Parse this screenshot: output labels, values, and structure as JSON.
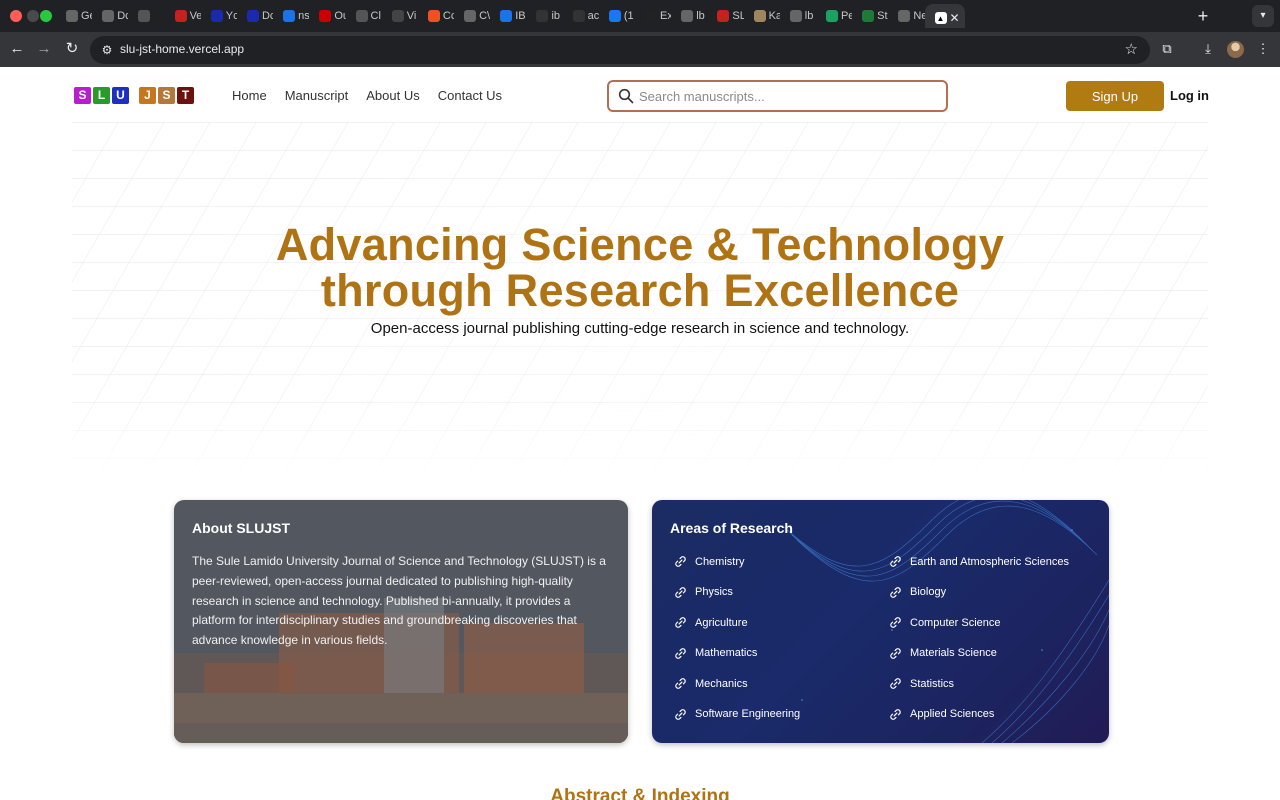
{
  "browser": {
    "tabs": [
      {
        "label": "Ge",
        "icon": "openai-icon"
      },
      {
        "label": "Dc",
        "icon": "openai-icon"
      },
      {
        "label": "",
        "icon": "link-icon"
      },
      {
        "label": "Ve",
        "icon": "gmail-icon"
      },
      {
        "label": "Yc",
        "icon": "notion-icon"
      },
      {
        "label": "Dc",
        "icon": "notion-icon"
      },
      {
        "label": "ns",
        "icon": "spinner-icon"
      },
      {
        "label": "Ou",
        "icon": "red-logo-icon"
      },
      {
        "label": "Cl",
        "icon": "link-icon"
      },
      {
        "label": "Vi",
        "icon": "vercel-icon"
      },
      {
        "label": "Cc",
        "icon": "microsoft-icon"
      },
      {
        "label": "C\\",
        "icon": "openai-icon"
      },
      {
        "label": "IB",
        "icon": "docs-icon"
      },
      {
        "label": "ib",
        "icon": "github-icon"
      },
      {
        "label": "ac",
        "icon": "github-icon"
      },
      {
        "label": "(1",
        "icon": "facebook-icon"
      },
      {
        "label": "Ex",
        "icon": "ex-icon"
      },
      {
        "label": "lb",
        "icon": "globe-icon"
      },
      {
        "label": "SL",
        "icon": "gmail-icon"
      },
      {
        "label": "Ka",
        "icon": "owl-icon"
      },
      {
        "label": "lb",
        "icon": "globe-icon"
      },
      {
        "label": "Pe",
        "icon": "play-icon"
      },
      {
        "label": "St",
        "icon": "sn-icon"
      },
      {
        "label": "Ne",
        "icon": "chrome-icon"
      }
    ],
    "url": "slu-jst-home.vercel.app"
  },
  "site": {
    "logo_letters": [
      {
        "ch": "S",
        "color": "#b81ecf"
      },
      {
        "ch": "L",
        "color": "#2a9a2a"
      },
      {
        "ch": "U",
        "color": "#1d2fbf"
      },
      {
        "ch": "J",
        "color": "#c8761d"
      },
      {
        "ch": "S",
        "color": "#b5783a"
      },
      {
        "ch": "T",
        "color": "#6e1010"
      }
    ],
    "nav": [
      "Home",
      "Manuscript",
      "About Us",
      "Contact Us"
    ],
    "search_placeholder": "Search manuscripts...",
    "signup_label": "Sign Up",
    "login_label": "Log in"
  },
  "hero": {
    "title_line1": "Advancing Science & Technology",
    "title_line2": "through Research Excellence",
    "subtitle": "Open-access journal publishing cutting-edge research in science and technology."
  },
  "about": {
    "title": "About SLUJST",
    "body": "The Sule Lamido University Journal of Science and Technology (SLUJST) is a peer-reviewed, open-access journal dedicated to publishing high-quality research in science and technology. Published bi-annually, it provides a platform for interdisciplinary studies and groundbreaking discoveries that advance knowledge in various fields."
  },
  "areas": {
    "title": "Areas of Research",
    "left": [
      "Chemistry",
      "Physics",
      "Agriculture",
      "Mathematics",
      "Mechanics",
      "Software Engineering"
    ],
    "right": [
      "Earth and Atmospheric Sciences",
      "Biology",
      "Computer Science",
      "Materials Science",
      "Statistics",
      "Applied Sciences"
    ]
  },
  "sections": {
    "abstract_title": "Abstract & Indexing"
  },
  "colors": {
    "accent": "#b07314",
    "button": "#b07b10",
    "search_border": "#b46e52"
  }
}
